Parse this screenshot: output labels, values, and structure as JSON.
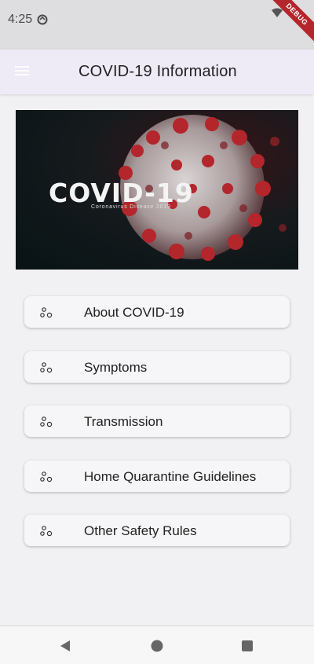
{
  "status_bar": {
    "time": "4:25",
    "sync_icon": "sync-icon",
    "wifi_icon": "wifi-icon",
    "debug_label": "DEBUG"
  },
  "app_bar": {
    "menu_icon": "hamburger-menu-icon",
    "title": "COVID-19 Information"
  },
  "banner": {
    "title": "COVID-19",
    "subtitle": "Coronavirus Disease 2019",
    "accent_color": "#b3262b"
  },
  "menu": {
    "items": [
      {
        "label": "About COVID-19",
        "icon": "bubbles-icon"
      },
      {
        "label": "Symptoms",
        "icon": "bubbles-icon"
      },
      {
        "label": "Transmission",
        "icon": "bubbles-icon"
      },
      {
        "label": "Home Quarantine Guidelines",
        "icon": "bubbles-icon"
      },
      {
        "label": "Other Safety Rules",
        "icon": "bubbles-icon"
      }
    ]
  },
  "nav_bar": {
    "back_icon": "back-icon",
    "home_icon": "home-icon",
    "recents_icon": "recents-icon"
  }
}
